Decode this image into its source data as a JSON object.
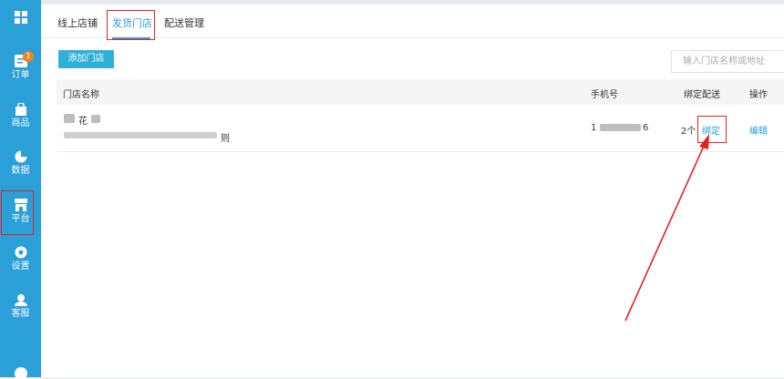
{
  "sidebar": {
    "items": [
      {
        "label": "",
        "icon": "grid-icon"
      },
      {
        "label": "订单",
        "icon": "order-icon",
        "badge": "1"
      },
      {
        "label": "商品",
        "icon": "bag-icon"
      },
      {
        "label": "数据",
        "icon": "pie-icon"
      },
      {
        "label": "平台",
        "icon": "store-icon"
      },
      {
        "label": "设置",
        "icon": "gear-icon"
      },
      {
        "label": "客服",
        "icon": "headset-icon"
      }
    ]
  },
  "tabs": [
    {
      "label": "线上店铺"
    },
    {
      "label": "发货门店"
    },
    {
      "label": "配送管理"
    }
  ],
  "toolbar": {
    "add_label": "添加门店",
    "search_placeholder": "输入门店名称或地址"
  },
  "table": {
    "headers": [
      "门店名称",
      "手机号",
      "绑定配送",
      "操作"
    ],
    "rows": [
      {
        "name_visible": "花",
        "address_end": "则",
        "phone_start": "1",
        "phone_end": "6",
        "delivery_count": "2个",
        "bind_link": "绑定",
        "edit_link": "编辑"
      }
    ]
  },
  "colors": {
    "sidebar": "#2a9fd8",
    "accent": "#2a9fd8",
    "button": "#2fb0d6",
    "annotation": "#e52222",
    "badge": "#f58220"
  }
}
